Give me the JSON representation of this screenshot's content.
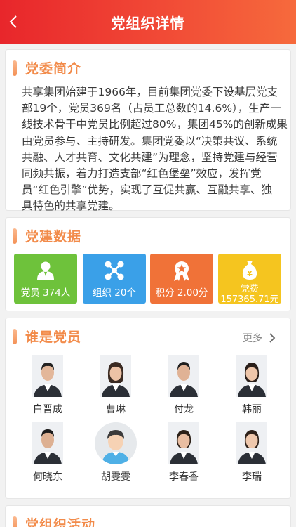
{
  "header": {
    "title": "党组织详情",
    "back_icon": "chevron-left-icon"
  },
  "intro": {
    "title": "党委简介",
    "lines": [
      "共享集团始建于1966年，目前集团党委下设基层党支",
      "部19个，党员369名（占员工总数的14.6%），生产一",
      "线技术骨干中党员比例超过80%，集团45%的创新成果",
      "由党员参与、主持研发。集团党委以“决策共议、系统",
      "共融、人才共育、文化共建”为理念，坚持党建与经营",
      "同频共振，着力打造支部“红色堡垒”效应，发挥党",
      "员“红色引擎”优势，实现了互促共赢、互融共享、独",
      "具特色的共享党建。"
    ]
  },
  "stats": {
    "title": "党建数据",
    "tiles": [
      {
        "label": "党员 374人",
        "icon": "member-icon",
        "color": "#6ec23b"
      },
      {
        "label": "组织 20个",
        "icon": "organization-icon",
        "color": "#3aa0e8"
      },
      {
        "label": "积分 2.00分",
        "icon": "medal-icon",
        "color": "#f07238"
      },
      {
        "label_top": "党费",
        "label_bottom": "157365.71元",
        "icon": "money-bag-icon",
        "color": "#f5c51f"
      }
    ]
  },
  "members": {
    "title": "谁是党员",
    "more": "更多",
    "people": [
      {
        "name": "白晋成"
      },
      {
        "name": "曹琳"
      },
      {
        "name": "付龙"
      },
      {
        "name": "韩丽"
      },
      {
        "name": "何晓东"
      },
      {
        "name": "胡雯雯"
      },
      {
        "name": "李春香"
      },
      {
        "name": "李瑞"
      }
    ]
  },
  "activity": {
    "title": "党组织活动"
  },
  "colors": {
    "header_start": "#e8262b",
    "header_end": "#f66a3c",
    "accent": "#f28b4a"
  }
}
